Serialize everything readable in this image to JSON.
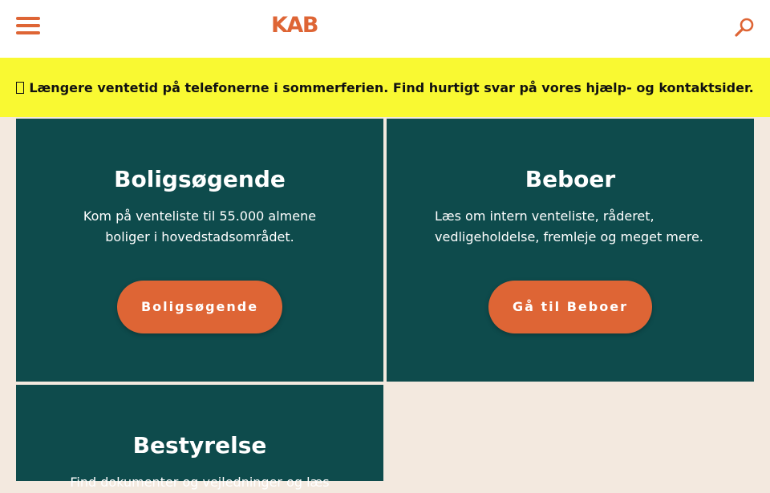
{
  "header": {
    "logo_text": "KAB",
    "menu_icon": "hamburger-menu-icon",
    "search_icon": "search-icon"
  },
  "banner": {
    "icon": "warning-icon",
    "text": "Længere ventetid på telefonerne i sommerferien. Find hurtigt svar på vores hjælp- og kontaktsider."
  },
  "cards": [
    {
      "title": "Boligsøgende",
      "text_line1": "Kom på venteliste til 55.000 almene",
      "text_line2": "boliger i hovedstadsområdet.",
      "button": "Boligsøgende"
    },
    {
      "title": "Beboer",
      "text_line1": "Læs om intern venteliste, råderet,",
      "text_line2": "vedligeholdelse, fremleje og meget mere.",
      "button": "Gå til Beboer"
    },
    {
      "title": "Bestyrelse",
      "text_line1": "Find dokumenter og vejledninger og læs"
    }
  ],
  "colors": {
    "brand_orange": "#de6535",
    "card_teal": "#0e4b4c",
    "banner_yellow": "#f9f932",
    "page_bg": "#f3e9df"
  }
}
